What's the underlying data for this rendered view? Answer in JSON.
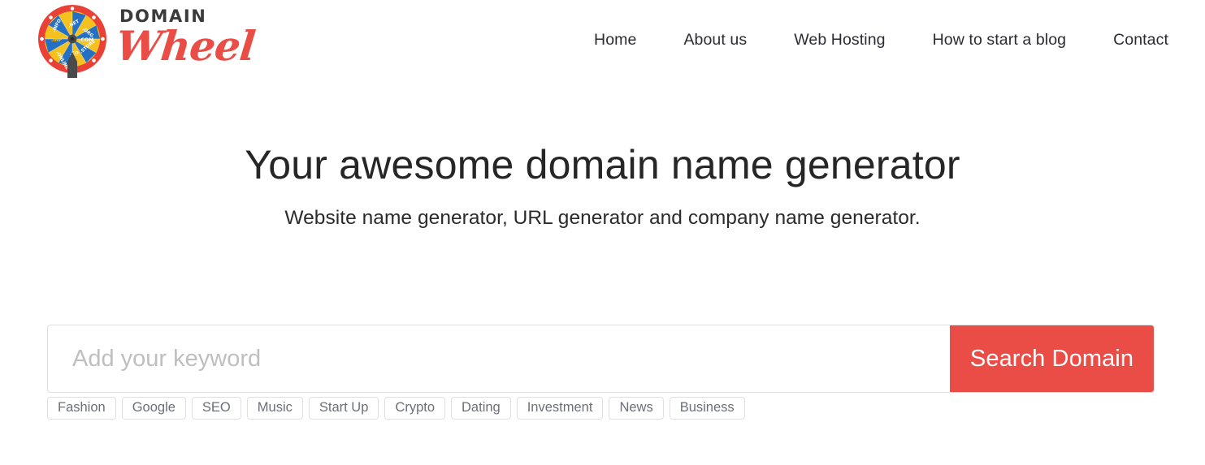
{
  "header": {
    "brand": {
      "logo_icon": "domain-wheel-icon",
      "word_top": "DOMAIN",
      "word_bottom": "Wheel",
      "wheel_segments": [
        ".COM",
        ".NET",
        ".INFO",
        ".ORG",
        ".BIZ",
        ".ONLINE",
        ".STORE",
        ".SITE",
        ".XYZ",
        ".CO",
        ".IO",
        ".ME"
      ],
      "colors": {
        "ring": "#ea4136",
        "segment_blue": "#2471c4",
        "segment_yellow": "#f5c11e",
        "pointer": "#4a4a4a",
        "wordmark_red": "#ea4c46",
        "wordmark_dark": "#3b3b3b"
      }
    },
    "nav": [
      {
        "label": "Home"
      },
      {
        "label": "About us"
      },
      {
        "label": "Web Hosting"
      },
      {
        "label": "How to start a blog"
      },
      {
        "label": "Contact"
      }
    ]
  },
  "hero": {
    "title": "Your awesome domain name generator",
    "subtitle": "Website name generator, URL generator and company name generator."
  },
  "search": {
    "placeholder": "Add your keyword",
    "value": "",
    "button_label": "Search Domain",
    "button_color": "#ea4c46"
  },
  "tags": [
    {
      "label": "Fashion"
    },
    {
      "label": "Google"
    },
    {
      "label": "SEO"
    },
    {
      "label": "Music"
    },
    {
      "label": "Start Up"
    },
    {
      "label": "Crypto"
    },
    {
      "label": "Dating"
    },
    {
      "label": "Investment"
    },
    {
      "label": "News"
    },
    {
      "label": "Business"
    }
  ]
}
